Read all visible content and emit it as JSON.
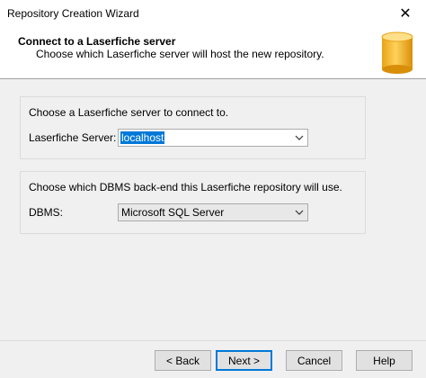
{
  "window": {
    "title": "Repository Creation Wizard",
    "close_glyph": "✕"
  },
  "header": {
    "title": "Connect to a Laserfiche server",
    "subtitle": "Choose which Laserfiche server will host the new repository.",
    "icon": "database-cylinder-icon",
    "icon_color": "#f0b429"
  },
  "server_group": {
    "caption": "Choose a Laserfiche server to connect to.",
    "field_label": "Laserfiche Server:",
    "field_value": "localhost"
  },
  "dbms_group": {
    "caption": "Choose which DBMS back-end this Laserfiche repository will use.",
    "field_label": "DBMS:",
    "field_value": "Microsoft SQL Server"
  },
  "buttons": {
    "back": "< Back",
    "next": "Next >",
    "cancel": "Cancel",
    "help": "Help"
  },
  "colors": {
    "accent": "#0078d7",
    "window_bg": "#f0f0f0"
  }
}
